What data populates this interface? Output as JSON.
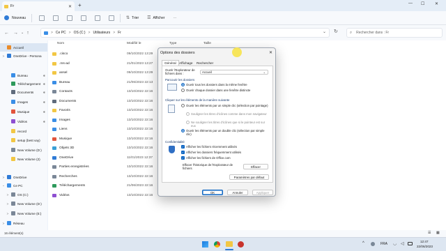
{
  "window": {
    "tab_title": "Fr",
    "close_tab": "✕",
    "add_tab": "+",
    "min": "—",
    "max": "☐",
    "close": "✕"
  },
  "toolbar": {
    "new_label": "Nouveau",
    "sort_label": "Trier",
    "view_label": "Afficher",
    "more": "···"
  },
  "address": {
    "back": "←",
    "forward": "→",
    "up": "↑",
    "refresh": "↻",
    "dropdown": "⌄",
    "crumbs": [
      "Ce PC",
      "OS (C:)",
      "Utilisateurs",
      "Fr"
    ],
    "sep": ">",
    "search_placeholder": "Rechercher dans : Fr"
  },
  "sidebar": {
    "items": [
      {
        "label": "Accueil",
        "color": "#e98b2a",
        "chev": ""
      },
      {
        "label": "OneDrive - Persona",
        "color": "#2f7bd6",
        "chev": ">"
      },
      {
        "label": "Bureau",
        "color": "#3a8ee6",
        "chev": ""
      },
      {
        "label": "Téléchargement",
        "color": "#2e9a5c",
        "chev": ""
      },
      {
        "label": "Documents",
        "color": "#5f6b7c",
        "chev": ""
      },
      {
        "label": "Images",
        "color": "#3a8ee6",
        "chev": ""
      },
      {
        "label": "Musique",
        "color": "#e2543c",
        "chev": ""
      },
      {
        "label": "Vidéos",
        "color": "#8e4fd1",
        "chev": ""
      },
      {
        "label": "record",
        "color": "#f2c744",
        "chev": ""
      },
      {
        "label": "setup (best vay)",
        "color": "#f2c744",
        "chev": ""
      },
      {
        "label": "New Volume (D:)",
        "color": "#7a8797",
        "chev": ""
      },
      {
        "label": "New Volume (2)",
        "color": "#f2c744",
        "chev": ""
      },
      {
        "label": "OneDrive",
        "color": "#2f7bd6",
        "chev": ">"
      },
      {
        "label": "Ce PC",
        "color": "#3a8ee6",
        "chev": "⌄"
      },
      {
        "label": "OS (C:)",
        "color": "#7a8797",
        "chev": ">"
      },
      {
        "label": "New Volume (D:)",
        "color": "#7a8797",
        "chev": ">"
      },
      {
        "label": "New Volume (E:)",
        "color": "#7a8797",
        "chev": ">"
      },
      {
        "label": "Réseau",
        "color": "#3a8ee6",
        "chev": ">"
      }
    ]
  },
  "columns": {
    "name": "Nom",
    "modified": "Modifié le",
    "type": "Type",
    "size": "Taille"
  },
  "files": [
    {
      "name": ".cisco",
      "date": "09/10/2022 13:29",
      "color": "#f2c744"
    },
    {
      "name": ".ms-ad",
      "date": "21/01/2023 13:27",
      "color": "#f2c744"
    },
    {
      "name": "ansel",
      "date": "09/10/2022 13:29",
      "color": "#f2c744"
    },
    {
      "name": "Bureau",
      "date": "21/06/2023 22:13",
      "color": "#3a8ee6"
    },
    {
      "name": "Contacts",
      "date": "13/10/2022 22:16",
      "color": "#7a8797"
    },
    {
      "name": "Documents",
      "date": "13/10/2022 22:16",
      "color": "#5f6b7c"
    },
    {
      "name": "Favoris",
      "date": "13/10/2022 22:16",
      "color": "#f2c744"
    },
    {
      "name": "Images",
      "date": "13/10/2022 22:16",
      "color": "#3a8ee6"
    },
    {
      "name": "Liens",
      "date": "13/10/2022 22:16",
      "color": "#3a8ee6"
    },
    {
      "name": "Musique",
      "date": "13/10/2022 22:16",
      "color": "#e2543c"
    },
    {
      "name": "Objets 3D",
      "date": "13/10/2022 22:16",
      "color": "#3aa0d6"
    },
    {
      "name": "OneDrive",
      "date": "11/01/2023 12:37",
      "color": "#2f7bd6"
    },
    {
      "name": "Parties enregistrées",
      "date": "13/10/2022 22:16",
      "color": "#7a8797"
    },
    {
      "name": "Recherches",
      "date": "13/10/2022 22:16",
      "color": "#7a8797"
    },
    {
      "name": "Téléchargements",
      "date": "21/06/2023 22:16",
      "color": "#2e9a5c"
    },
    {
      "name": "Vidéos",
      "date": "13/10/2022 22:16",
      "color": "#8e4fd1"
    }
  ],
  "status": {
    "count": "16 élément(s)"
  },
  "dialog": {
    "title": "Options des dossiers",
    "close": "✕",
    "tabs": [
      "Général",
      "Affichage",
      "Rechercher"
    ],
    "open_label": "Ouvrir l'Explorateur de fichiers dans :",
    "open_value": "Accueil",
    "combo_chev": "⌄",
    "browse_group": "Parcourir les dossiers",
    "browse_opts": [
      "Ouvrir tous les dossiers dans la même fenêtre",
      "Ouvrir chaque dossier dans une fenêtre distincte"
    ],
    "click_group": "Cliquer sur les éléments de la manière suivante",
    "click_single": "Ouvrir les éléments par un simple clic (sélection par pointage)",
    "click_underline_a": "Souligner les titres d'icônes comme dans mon navigateur",
    "click_underline_b": "Ne souligner les titres d'icônes que si le pointeur est sur eux",
    "click_double": "Ouvrir les éléments par un double clic (sélection par simple clic)",
    "privacy_group": "Confidentialité",
    "privacy_opts": [
      "Afficher les fichiers récemment utilisés",
      "Afficher les dossiers fréquemment utilisés",
      "Afficher les fichiers de Office.com"
    ],
    "clear_label": "Effacer l'historique de l'Explorateur de fichiers",
    "clear_btn": "Effacer",
    "defaults_btn": "Paramètres par défaut",
    "ok": "OK",
    "cancel": "Annuler",
    "apply": "Appliquer"
  },
  "tray": {
    "chev": "^",
    "lang": "FRA",
    "time": "12:47",
    "date": "22/06/2023"
  }
}
